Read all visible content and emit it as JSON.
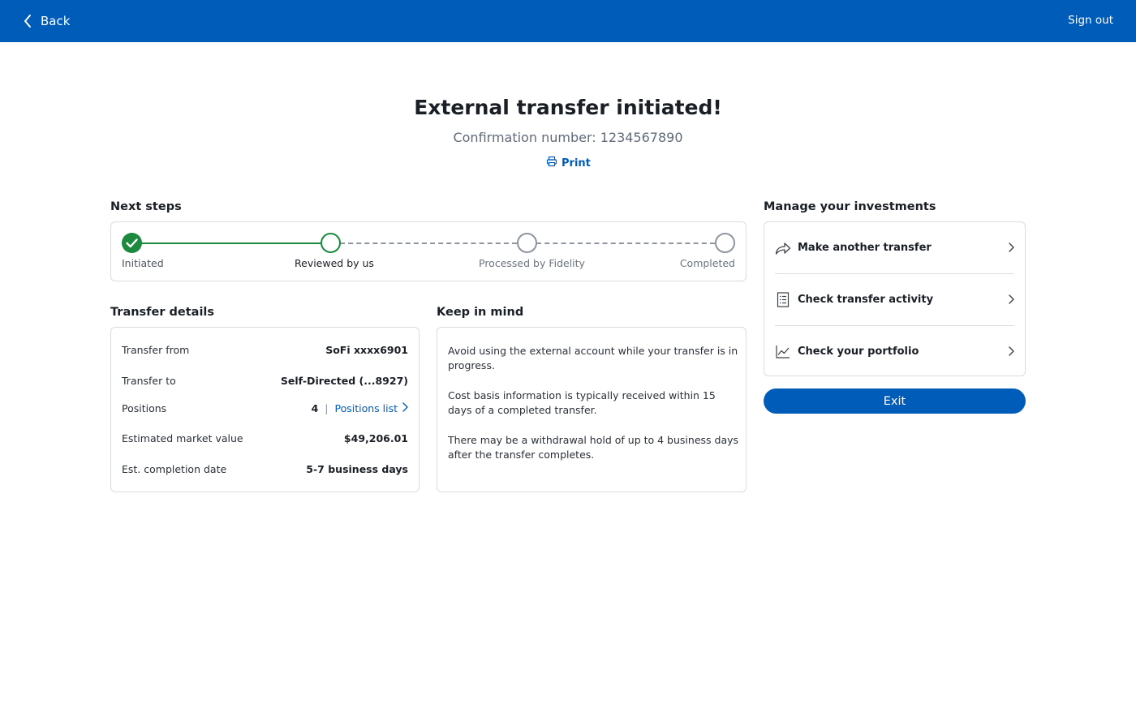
{
  "header": {
    "back_label": "Back",
    "signout_label": "Sign out",
    "color": "#005cb9"
  },
  "main": {
    "title": "External transfer initiated!",
    "confirmation": "Confirmation number: 1234567890",
    "print_label": "Print"
  },
  "next_steps": {
    "label": "Next steps",
    "steps": [
      {
        "label": "Initiated",
        "status": "done"
      },
      {
        "label": "Reviewed by us",
        "status": "current"
      },
      {
        "label": "Processed by Fidelity",
        "status": "pending"
      },
      {
        "label": "Completed",
        "status": "pending"
      }
    ],
    "done_color": "#1b8a3f"
  },
  "transfer_details": {
    "label": "Transfer details",
    "rows": [
      {
        "label": "Transfer from",
        "value": "SoFi xxxx6901"
      },
      {
        "label": "Transfer to",
        "value": "Self-Directed (...8927)"
      },
      {
        "label": "Positions",
        "value": "4",
        "link": "Positions list"
      },
      {
        "label": "Estimated market value",
        "value": "$49,206.01"
      },
      {
        "label": "Est. completion date",
        "value": "5-7 business days"
      }
    ]
  },
  "keep_in_mind": {
    "label": "Keep in mind",
    "items": [
      "Avoid using the external account while your transfer is in progress.",
      "Cost basis information is typically received within 15 days of a completed transfer.",
      "There may be a withdrawal hold of up to 4 business days after the transfer completes."
    ]
  },
  "manage": {
    "label": "Manage your investments",
    "items": [
      {
        "label": "Make another transfer",
        "icon": "share-arrow-icon"
      },
      {
        "label": "Check transfer activity",
        "icon": "receipt-list-icon"
      },
      {
        "label": "Check your portfolio",
        "icon": "line-chart-icon"
      }
    ],
    "exit_label": "Exit"
  }
}
